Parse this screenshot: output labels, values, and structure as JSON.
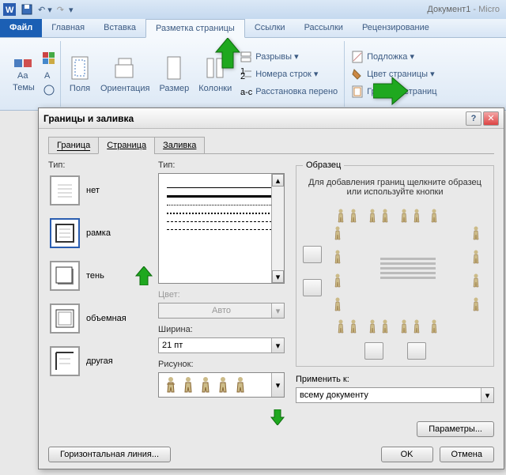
{
  "title": {
    "doc": "Документ1",
    "app": " - Micro"
  },
  "tabs": {
    "file": "Файл",
    "home": "Главная",
    "insert": "Вставка",
    "layout": "Разметка страницы",
    "refs": "Ссылки",
    "mail": "Рассылки",
    "review": "Рецензирование"
  },
  "ribbon": {
    "themes": "Темы",
    "fields": "Поля",
    "orient": "Ориентация",
    "size": "Размер",
    "cols": "Колонки",
    "breaks": "Разрывы ▾",
    "lines": "Номера строк ▾",
    "hyphen": "Расстановка перено",
    "watermark": "Подложка ▾",
    "pagecolor": "Цвет страницы ▾",
    "borders": "Границы страниц"
  },
  "dialog": {
    "title": "Границы и заливка",
    "tabs": {
      "border": "Граница",
      "page": "Страница",
      "fill": "Заливка"
    },
    "typeLbl": "Тип:",
    "types": {
      "none": "нет",
      "box": "рамка",
      "shadow": "тень",
      "threeD": "объемная",
      "custom": "другая"
    },
    "styleLbl": "Тип:",
    "colorLbl": "Цвет:",
    "colorVal": "Авто",
    "widthLbl": "Ширина:",
    "widthVal": "21 пт",
    "artLbl": "Рисунок:",
    "previewLbl": "Образец",
    "previewHint": "Для добавления границ щелкните образец или используйте кнопки",
    "applyLbl": "Применить к:",
    "applyVal": "всему документу",
    "params": "Параметры...",
    "hline": "Горизонтальная линия...",
    "ok": "OK",
    "cancel": "Отмена"
  }
}
